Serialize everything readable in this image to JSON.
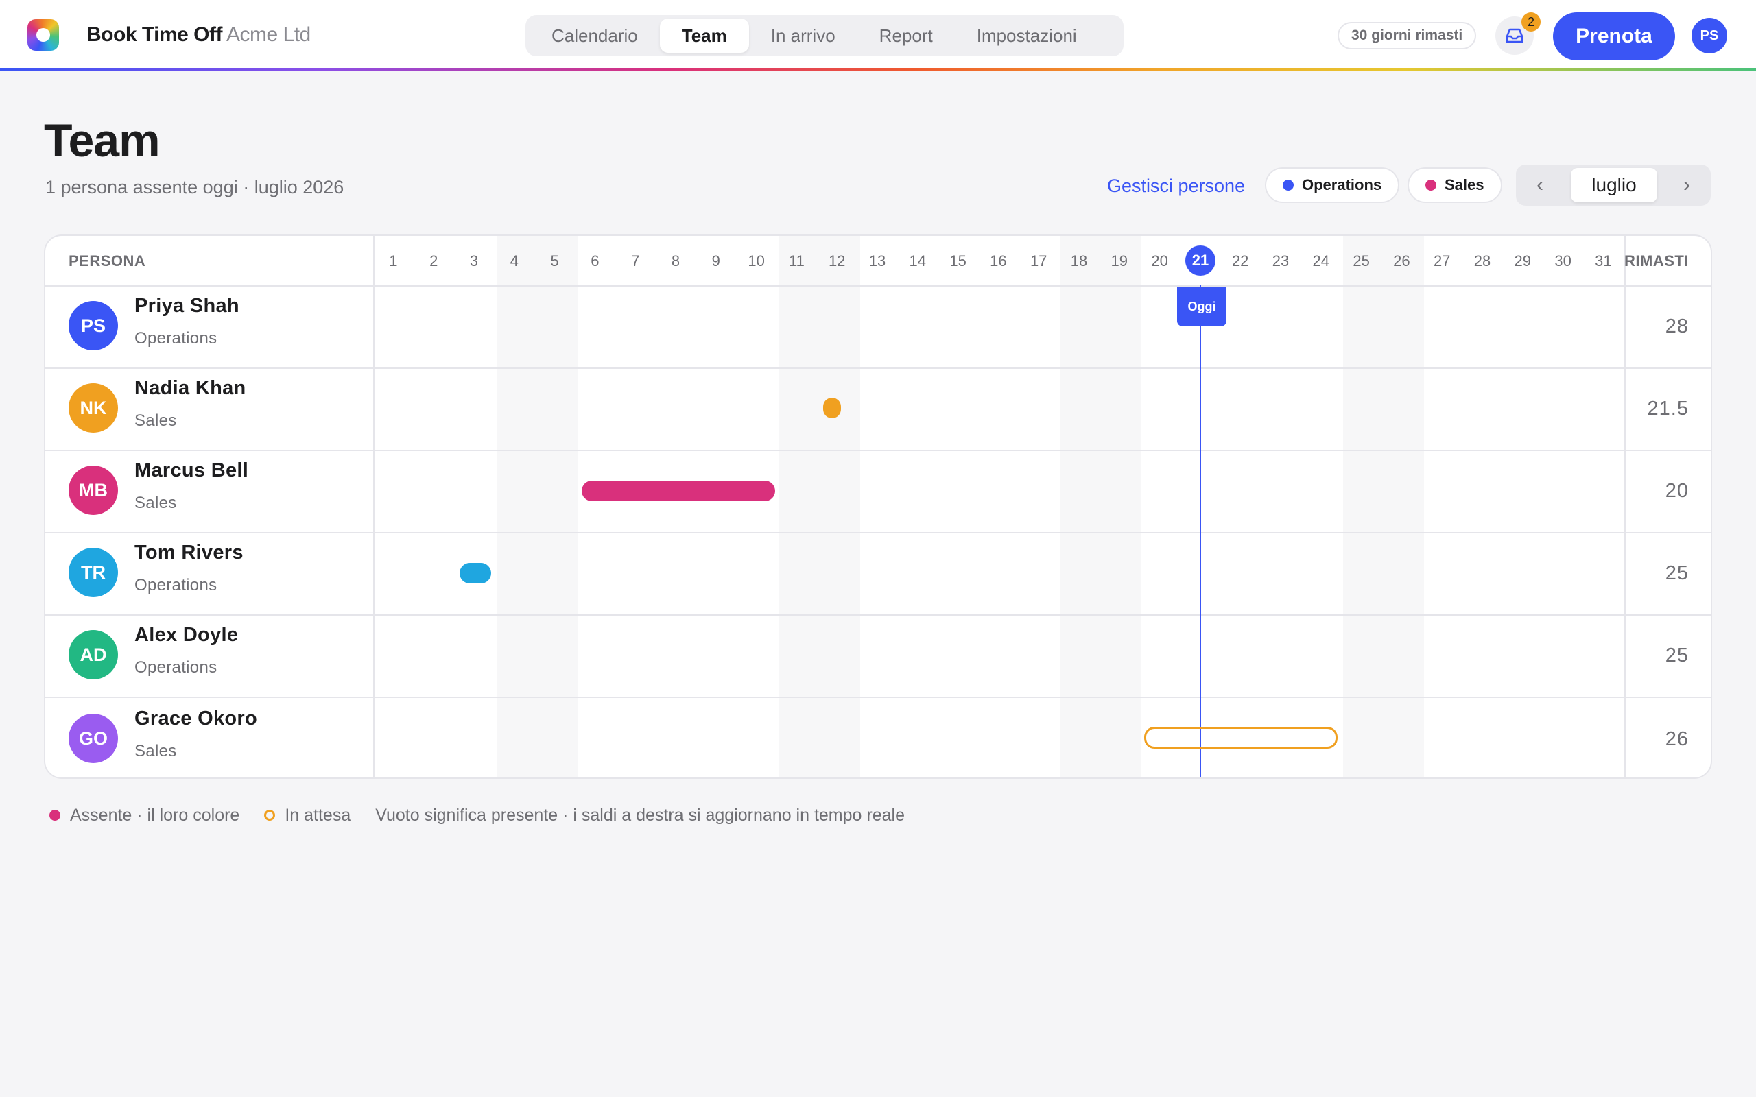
{
  "header": {
    "brand": "Book Time Off",
    "org": "Acme Ltd",
    "tabs": [
      {
        "label": "Calendario",
        "active": false
      },
      {
        "label": "Team",
        "active": true
      },
      {
        "label": "In arrivo",
        "active": false
      },
      {
        "label": "Report",
        "active": false
      },
      {
        "label": "Impostazioni",
        "active": false
      }
    ],
    "days_left": "30 giorni rimasti",
    "inbox_count": "2",
    "book_label": "Prenota",
    "user_initials": "PS"
  },
  "page": {
    "title": "Team",
    "subtitle": "1 persona assente oggi · luglio 2026",
    "manage_link": "Gestisci persone",
    "filters": [
      {
        "label": "Operations",
        "color": "#3a55f5"
      },
      {
        "label": "Sales",
        "color": "#d9307c"
      }
    ],
    "month": "luglio",
    "prev_icon": "‹",
    "next_icon": "›"
  },
  "grid": {
    "person_header": "PERSONA",
    "balance_header": "RIMASTI",
    "days": [
      "1",
      "2",
      "3",
      "4",
      "5",
      "6",
      "7",
      "8",
      "9",
      "10",
      "11",
      "12",
      "13",
      "14",
      "15",
      "16",
      "17",
      "18",
      "19",
      "20",
      "21",
      "22",
      "23",
      "24",
      "25",
      "26",
      "27",
      "28",
      "29",
      "30",
      "31"
    ],
    "today": "21",
    "today_tag": "Oggi",
    "people": [
      {
        "initials": "PS",
        "name": "Priya Shah",
        "team": "Operations",
        "avatar_color": "#3a55f5",
        "balance": "28"
      },
      {
        "initials": "NK",
        "name": "Nadia Khan",
        "team": "Sales",
        "avatar_color": "#f0a020",
        "balance": "21.5"
      },
      {
        "initials": "MB",
        "name": "Marcus Bell",
        "team": "Sales",
        "avatar_color": "#d9307c",
        "balance": "20"
      },
      {
        "initials": "TR",
        "name": "Tom Rivers",
        "team": "Operations",
        "avatar_color": "#1fa6e0",
        "balance": "25"
      },
      {
        "initials": "AD",
        "name": "Alex Doyle",
        "team": "Operations",
        "avatar_color": "#22b883",
        "balance": "25"
      },
      {
        "initials": "GO",
        "name": "Grace Okoro",
        "team": "Sales",
        "avatar_color": "#9a5cf0",
        "balance": "26"
      }
    ]
  },
  "legend": {
    "absent": "Assente · il loro colore",
    "pending": "In attesa",
    "note": "Vuoto significa presente · i saldi a destra si aggiornano in tempo reale"
  }
}
